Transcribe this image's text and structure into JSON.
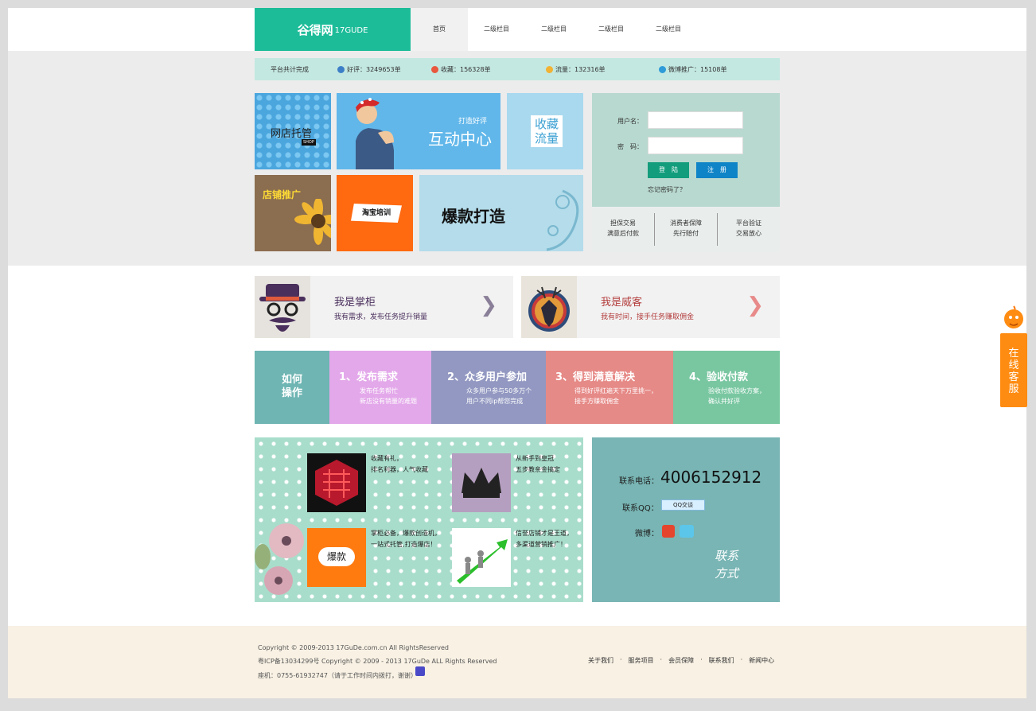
{
  "header": {
    "logo_cn": "谷得网",
    "logo_en": "17GUDE",
    "nav": [
      "首页",
      "二级栏目",
      "二级栏目",
      "二级栏目",
      "二级栏目"
    ]
  },
  "stats": {
    "intro": "平台共计完成",
    "good": "好评：3249653单",
    "fav": "收藏：156328单",
    "flow": "流量：132316单",
    "weibo": "微博推广：15108单"
  },
  "tiles": {
    "shop": "网店托管",
    "shop_badge": "SHOP",
    "hu_small": "打造好评",
    "hu_big": "互动中心",
    "fav_1": "收藏",
    "fav_2": "流量",
    "store": "店铺推广",
    "train": "淘宝培训",
    "hot": "爆款打造"
  },
  "login": {
    "user_label": "用户名：",
    "pass_label": "密　码：",
    "login_btn": "登　陆",
    "reg_btn": "注　册",
    "forgot": "忘记密码了？",
    "g1a": "担保交易",
    "g1b": "满意后付款",
    "g2a": "消费者保障",
    "g2b": "先行赔付",
    "g3a": "平台验证",
    "g3b": "交易放心"
  },
  "roles": {
    "boss_title": "我是掌柜",
    "boss_desc": "我有需求，发布任务提升销量",
    "guest_title": "我是威客",
    "guest_desc": "我有时间，接手任务赚取佣金"
  },
  "steps": {
    "how_1": "如何",
    "how_2": "操作",
    "s1_t": "1、发布需求",
    "s1_d1": "发布任务帮忙",
    "s1_d2": "新店没有销量的难题",
    "s2_t": "2、众多用户参加",
    "s2_d1": "众多用户参与50多万个",
    "s2_d2": "用户不同ip帮您完成",
    "s3_t": "3、得到满意解决",
    "s3_d1": "得到好评红遍天下万里挑一，",
    "s3_d2": "接手方赚取佣金",
    "s4_t": "4、验收付款",
    "s4_d1": "验收付款验收方案，",
    "s4_d2": "确认并好评",
    "colors": [
      "#6eb5b3",
      "#e3a8ea",
      "#9298c1",
      "#e68a87",
      "#79c7a1"
    ]
  },
  "features": {
    "f1a": "收藏有礼，",
    "f1b": "排名利器，人气收藏",
    "f2a": "从新手到皇冠",
    "f2b": "五步教亲金搞定",
    "f3_badge": "爆款",
    "f3a": "掌柜必备，爆款创造机，",
    "f3b": "一站式托管,打造爆店！",
    "f4a": "信誉店铺才是王道，",
    "f4b": "多渠道营销推广！"
  },
  "contact": {
    "phone_label": "联系电话：",
    "phone": "4006152912",
    "qq_label": "联系QQ：",
    "qq_btn": "QQ交谈",
    "weibo_label": "微博：",
    "sig_1": "联系",
    "sig_2": "方式"
  },
  "footer": {
    "line1": "Copyright © 2009-2013 17GuDe.com.cn All RightsReserved",
    "line2": "粤ICP备13034299号 Copyright © 2009 - 2013 17GuDe ALL Rights Reserved",
    "line3": "座机：0755-61932747（请于工作时间内拨打，谢谢）",
    "links": [
      "关于我们",
      "服务项目",
      "会员保障",
      "联系我们",
      "新闻中心"
    ],
    "sep": "·"
  },
  "side": {
    "label_1": "在",
    "label_2": "线",
    "label_3": "客",
    "label_4": "服"
  }
}
